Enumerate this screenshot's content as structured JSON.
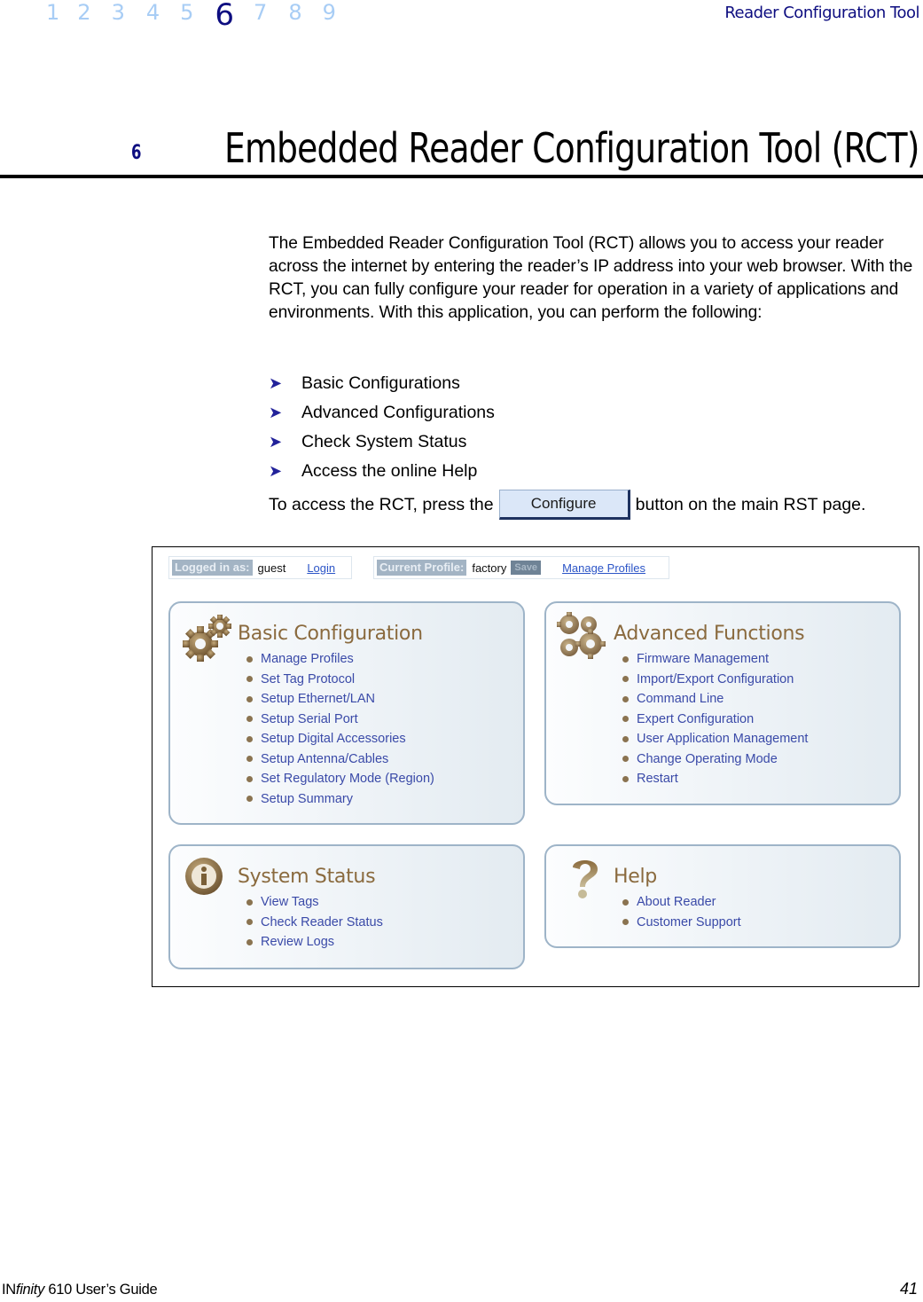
{
  "header": {
    "chapters": [
      "1",
      "2",
      "3",
      "4",
      "5",
      "6",
      "7",
      "8",
      "9"
    ],
    "active_chapter": "6",
    "running_title": "Reader Configuration Tool"
  },
  "chapter": {
    "number": "6",
    "title": "Embedded Reader Configuration Tool (RCT)"
  },
  "intro": "The Embedded Reader Configuration Tool (RCT) allows you to access your reader across the internet by entering the reader’s IP address into your web browser. With the RCT, you can fully configure your reader for operation in a variety of applications and environments. With this application, you can perform the following:",
  "bullets": [
    "Basic Configurations",
    "Advanced Configurations",
    "Check System Status",
    "Access the online Help"
  ],
  "access": {
    "before": "To access the RCT, press the",
    "button_label": "Configure",
    "after": "button on the main RST page."
  },
  "rct": {
    "login": {
      "label": "Logged in as:",
      "user": "guest",
      "link": "Login"
    },
    "profile": {
      "label": "Current Profile:",
      "value": "factory",
      "save": "Save",
      "link": "Manage Profiles"
    },
    "panels": {
      "basic": {
        "icon": "gears-icon",
        "title": "Basic Configuration",
        "items": [
          "Manage Profiles",
          "Set Tag Protocol",
          "Setup Ethernet/LAN",
          "Setup Serial Port",
          "Setup Digital Accessories",
          "Setup Antenna/Cables",
          "Set Regulatory Mode (Region)",
          "Setup Summary"
        ]
      },
      "advanced": {
        "icon": "multi-gears-icon",
        "title": "Advanced Functions",
        "items": [
          "Firmware Management",
          "Import/Export Configuration",
          "Command Line",
          "Expert Configuration",
          "User Application Management",
          "Change Operating Mode",
          "Restart"
        ]
      },
      "status": {
        "icon": "info-icon",
        "title": "System Status",
        "items": [
          "View Tags",
          "Check Reader Status",
          "Review Logs"
        ]
      },
      "help": {
        "icon": "question-icon",
        "title": "Help",
        "items": [
          "About Reader",
          "Customer Support"
        ]
      }
    }
  },
  "footer": {
    "brand_prefix": "IN",
    "brand_italic": "finity",
    "guide": " 610 User’s Guide",
    "page": "41"
  },
  "colors": {
    "nav_inactive": "#a8cdf5",
    "nav_active": "#0d0d80",
    "bullet_arrow": "#22229a",
    "panel_title": "#8a6a3e",
    "panel_link": "#3a4aa8",
    "panel_border": "#9eb4c8"
  }
}
